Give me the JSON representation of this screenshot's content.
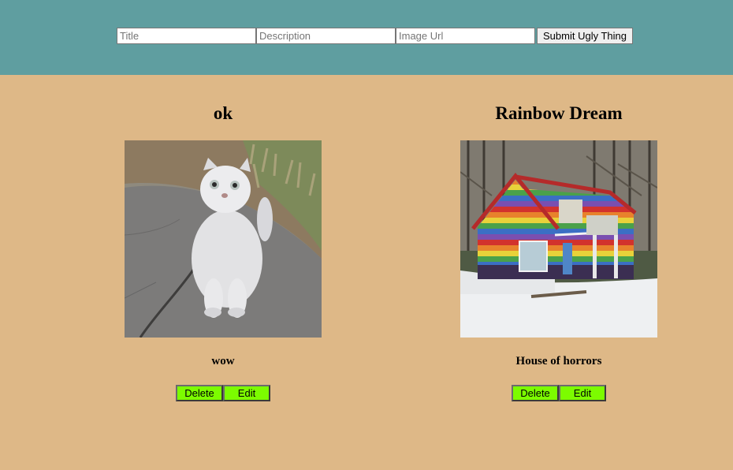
{
  "form": {
    "title_placeholder": "Title",
    "description_placeholder": "Description",
    "image_url_placeholder": "Image Url",
    "submit_label": "Submit Ugly Thing"
  },
  "colors": {
    "header": "#5f9ea0",
    "background": "#deb887",
    "button": "#7cfc00"
  },
  "things": [
    {
      "title": "ok",
      "image": "white-cat-photo",
      "description": "wow",
      "delete_label": "Delete",
      "edit_label": "Edit"
    },
    {
      "title": "Rainbow Dream",
      "image": "rainbow-house-photo",
      "description": "House of horrors",
      "delete_label": "Delete",
      "edit_label": "Edit"
    }
  ]
}
